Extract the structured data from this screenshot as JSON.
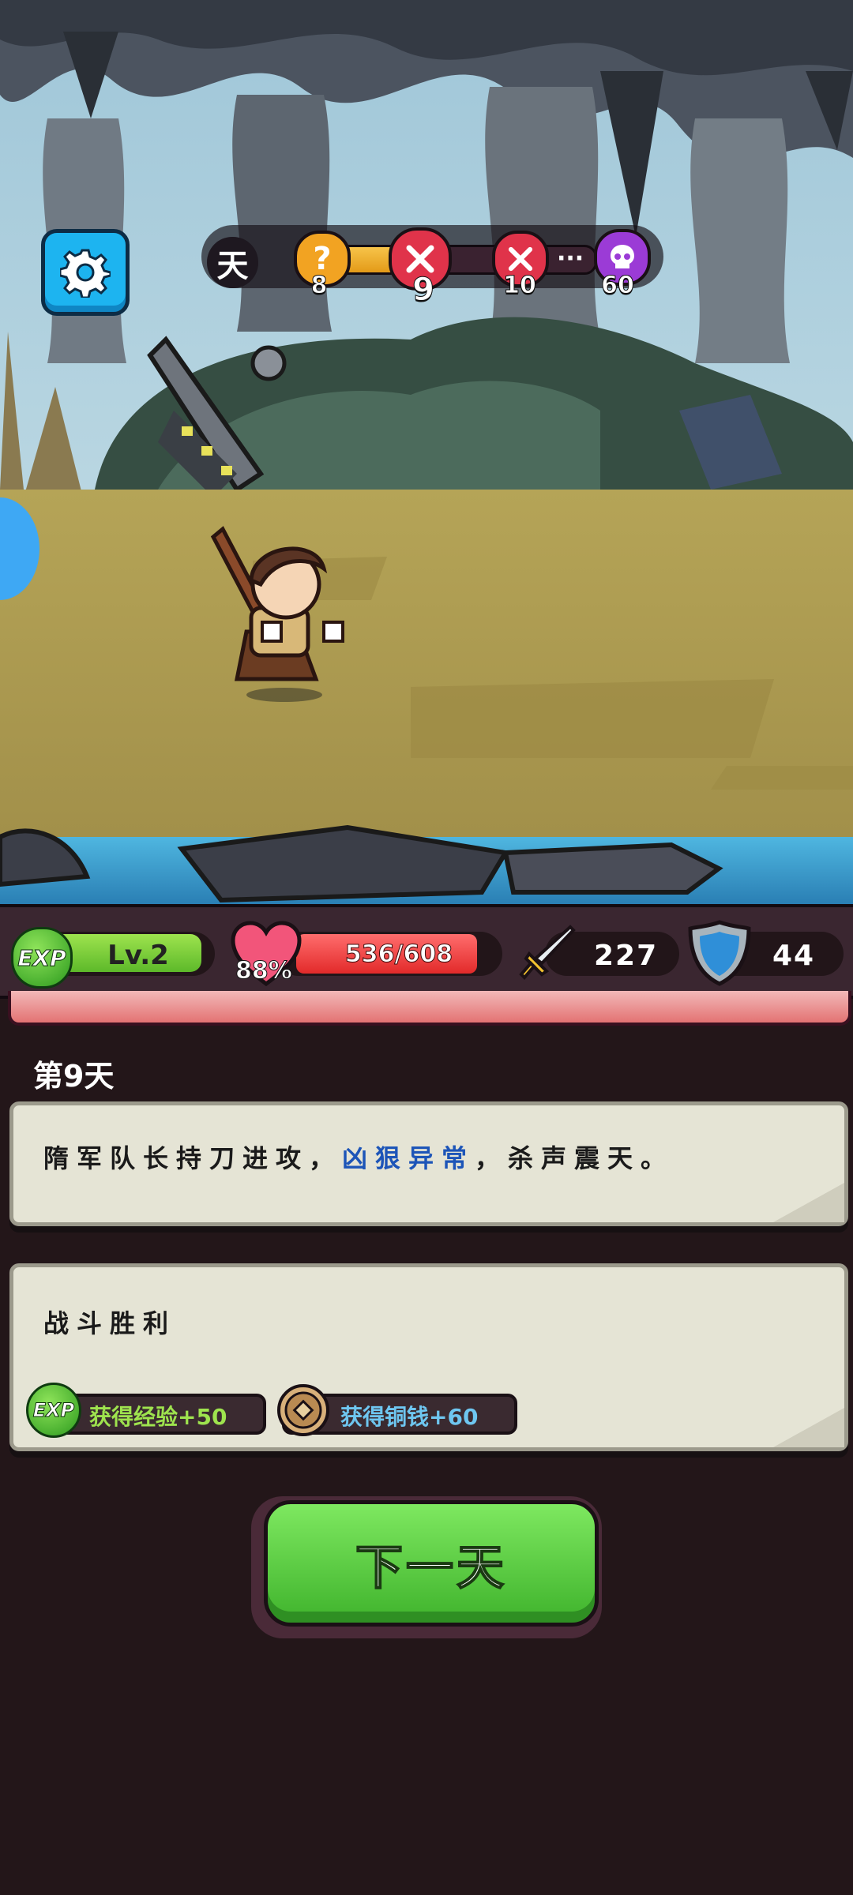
{
  "top_bar": {
    "day_label": "天",
    "progress": 0.3,
    "nodes": [
      {
        "icon": "question-mark-icon",
        "number": "8",
        "color": "#f2a322"
      },
      {
        "icon": "crossed-swords-icon",
        "number": "9",
        "color": "#e0334a"
      },
      {
        "icon": "crossed-swords-icon",
        "number": "10",
        "color": "#e0334a"
      },
      {
        "icon": "skull-icon",
        "number": "60",
        "color": "#9b3bd6"
      }
    ],
    "ellipsis": "···"
  },
  "stats": {
    "exp_badge": "EXP",
    "level": "Lv.2",
    "hp": "536/608",
    "hp_percent": "88%",
    "hp_fraction": 0.88,
    "attack": "227",
    "defense": "44"
  },
  "log": {
    "day_title": "第9天",
    "event_prefix": "隋军队长持刀进攻，",
    "event_highlight": "凶狠异常",
    "event_suffix": "，杀声震天。",
    "result_title": "战斗胜利",
    "reward_exp_badge": "EXP",
    "reward_exp": "获得经验+50",
    "reward_coin": "获得铜钱+60"
  },
  "next_button": "下一天",
  "colors": {
    "exp_green": "#5db92a",
    "hp_red": "#e22a2a",
    "highlight_blue": "#1d55b8",
    "button_green": "#3fb32c",
    "settings_blue": "#1db4f0"
  }
}
